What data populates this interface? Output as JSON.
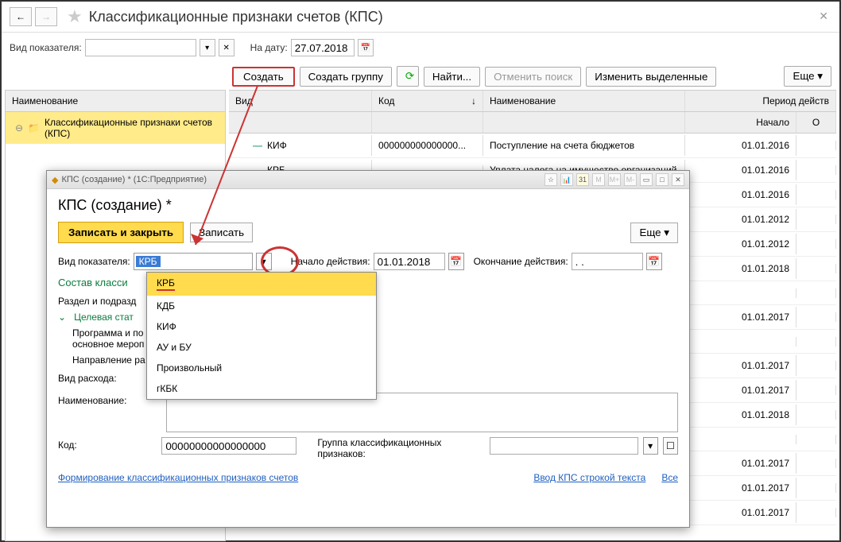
{
  "header": {
    "title": "Классификационные признаки счетов (КПС)"
  },
  "filter": {
    "vid_label": "Вид показателя:",
    "date_label": "На дату:",
    "date_value": "27.07.2018"
  },
  "toolbar": {
    "create": "Создать",
    "create_group": "Создать группу",
    "find": "Найти...",
    "cancel_search": "Отменить поиск",
    "change_selected": "Изменить выделенные",
    "more": "Еще"
  },
  "tree": {
    "header": "Наименование",
    "item": "Классификационные признаки счетов (КПС)"
  },
  "grid": {
    "col_vid": "Вид",
    "col_code": "Код",
    "col_name": "Наименование",
    "col_period": "Период действ",
    "col_start": "Начало",
    "col_end": "О",
    "sort_arrow": "↓",
    "rows": [
      {
        "vid": "КИФ",
        "code": "000000000000000...",
        "name": "Поступление на счета бюджетов",
        "start": "01.01.2016"
      },
      {
        "vid": "КРБ",
        "code": "",
        "name": "Уплата налога на имущество организаций",
        "start": "01.01.2016"
      },
      {
        "vid": "",
        "code": "",
        "name": "",
        "start": "01.01.2016"
      },
      {
        "vid": "",
        "code": "",
        "name": "",
        "start": "01.01.2012"
      },
      {
        "vid": "",
        "code": "",
        "name": "",
        "start": "01.01.2012"
      },
      {
        "vid": "",
        "code": "",
        "name": "",
        "start": "01.01.2018"
      },
      {
        "vid": "",
        "code": "",
        "name": "",
        "start": ""
      },
      {
        "vid": "",
        "code": "",
        "name": "",
        "start": "01.01.2017"
      },
      {
        "vid": "",
        "code": "",
        "name": "",
        "start": ""
      },
      {
        "vid": "",
        "code": "",
        "name": "",
        "start": "01.01.2017"
      },
      {
        "vid": "",
        "code": "",
        "name": "",
        "start": "01.01.2017"
      },
      {
        "vid": "",
        "code": "",
        "name": "",
        "start": "01.01.2018"
      },
      {
        "vid": "",
        "code": "",
        "name": "",
        "start": ""
      },
      {
        "vid": "",
        "code": "",
        "name": "",
        "start": "01.01.2017"
      },
      {
        "vid": "",
        "code": "",
        "name": "",
        "start": "01.01.2017"
      },
      {
        "vid": "",
        "code": "",
        "name": "",
        "start": "01.01.2017"
      }
    ]
  },
  "dialog": {
    "window_title": "КПС (создание) * (1С:Предприятие)",
    "title": "КПС (создание) *",
    "save_close": "Записать и закрыть",
    "save": "Записать",
    "more": "Еще",
    "vid_label": "Вид показателя:",
    "vid_value": "КРБ",
    "start_label": "Начало действия:",
    "start_value": "01.01.2018",
    "end_label": "Окончание действия:",
    "end_value": ". .",
    "section": "Состав класси",
    "row_razdel": "Раздел и подразд",
    "row_target": "Целевая стат",
    "row_program": "Программа и по",
    "row_event": "основное мероп",
    "row_direction": "Направление ра",
    "row_expense": "Вид расхода:",
    "row_name": "Наименование:",
    "row_code": "Код:",
    "code_value": "00000000000000000",
    "group_label": "Группа классификационных признаков:",
    "link_form": "Формирование классификационных признаков счетов",
    "link_input": "Ввод КПС строкой текста",
    "all": "Все",
    "dropdown": [
      "КРБ",
      "КДБ",
      "КИФ",
      "АУ и БУ",
      "Произвольный",
      "гКБК"
    ]
  }
}
